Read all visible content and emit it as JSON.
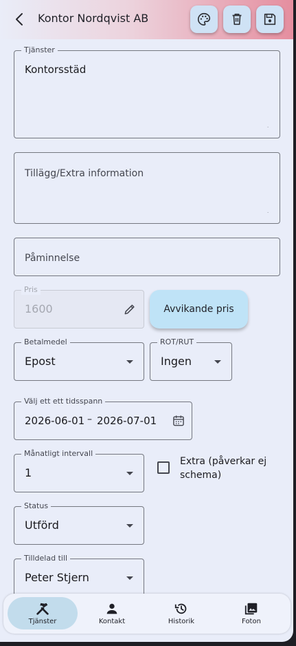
{
  "header": {
    "title": "Kontor Nordqvist AB",
    "actions": [
      {
        "name": "palette-button",
        "icon": "palette-icon"
      },
      {
        "name": "delete-button",
        "icon": "trash-icon"
      },
      {
        "name": "save-button",
        "icon": "save-icon"
      }
    ]
  },
  "form": {
    "services": {
      "label": "Tjänster",
      "value": "Kontorsstäd"
    },
    "extra_info": {
      "placeholder": "Tillägg/Extra information"
    },
    "reminder": {
      "placeholder": "Påminnelse"
    },
    "price": {
      "label": "Pris",
      "value": "1600",
      "disabled": true
    },
    "deviating_price_button": "Avvikande pris",
    "payment_method": {
      "label": "Betalmedel",
      "value": "Epost"
    },
    "rot_rut": {
      "label": "ROT/RUT",
      "value": "Ingen"
    },
    "date_range": {
      "label": "Välj ett ett tidsspann",
      "start": "2026-06-01",
      "separator": "–",
      "end": "2026-07-01"
    },
    "monthly_interval": {
      "label": "Månatligt intervall",
      "value": "1"
    },
    "extra_checkbox": {
      "line1": "Extra (påverkar ej",
      "line2": "schema)",
      "checked": false
    },
    "status": {
      "label": "Status",
      "value": "Utförd"
    },
    "assigned_to": {
      "label": "Tilldelad till",
      "value": "Peter Stjern"
    }
  },
  "nav": {
    "items": [
      {
        "label": "Tjänster",
        "icon": "tools-icon",
        "active": true
      },
      {
        "label": "Kontakt",
        "icon": "person-icon",
        "active": false
      },
      {
        "label": "Historik",
        "icon": "history-icon",
        "active": false
      },
      {
        "label": "Foton",
        "icon": "photos-icon",
        "active": false
      }
    ]
  },
  "colors": {
    "background": "#e9edf9",
    "appbar_gradient_end": "#e58e9f",
    "action_button": "#cfe2f5",
    "nav_active": "#c2dcec",
    "outline": "#74777f"
  }
}
